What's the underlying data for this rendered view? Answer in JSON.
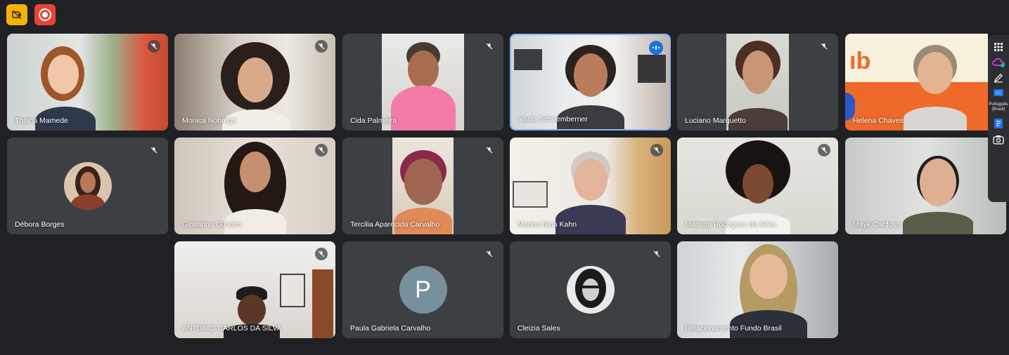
{
  "colors": {
    "background": "#202124",
    "tile": "#3c4043",
    "speaking_border": "#8ab4f8",
    "recording": "#ea4335",
    "camera_warning": "#f4b400"
  },
  "toolbar": {
    "camera_icon": "camera-off-icon",
    "record_icon": "record-icon"
  },
  "participants": [
    {
      "name": "Thainá Mamede",
      "muted": true
    },
    {
      "name": "Monica Nobrega",
      "muted": true
    },
    {
      "name": "Cida Palmeira",
      "muted": true
    },
    {
      "name": "Vania Schoemberner",
      "muted": false,
      "speaking": true
    },
    {
      "name": "Luciano Marquetto",
      "muted": true
    },
    {
      "name": "Helena Chaves",
      "muted": false
    },
    {
      "name": "Débora Borges",
      "muted": true
    },
    {
      "name": "Giovanna Gundim",
      "muted": true
    },
    {
      "name": "Tercilia Aparecida Carvalho",
      "muted": true
    },
    {
      "name": "Marina Nina Kahn",
      "muted": true
    },
    {
      "name": "Mariana Rodrigues da Silva",
      "muted": true
    },
    {
      "name": "Mayk Cardoso",
      "muted": false
    },
    {
      "name": "ANTONIO CARLOS DA SILVA",
      "muted": true
    },
    {
      "name": "Paula Gabriela Carvalho",
      "muted": true,
      "avatar_letter": "P"
    },
    {
      "name": "Cleizia Sales",
      "muted": true
    },
    {
      "name": "Relacionamento Fundo Brasil",
      "muted": false
    }
  ],
  "side_panel": {
    "language_label": "Português (Brasil)"
  }
}
